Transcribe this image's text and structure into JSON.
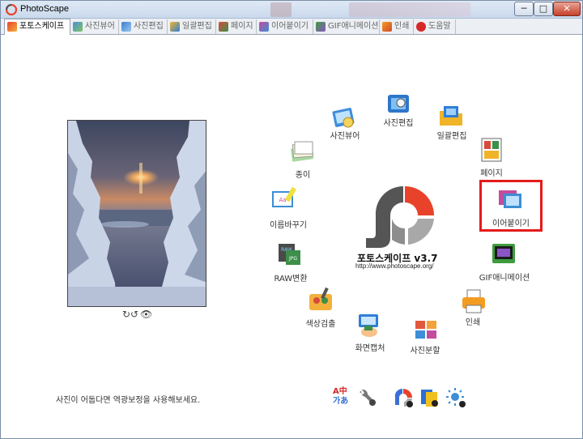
{
  "window": {
    "title": "PhotoScape",
    "min_label": "─",
    "max_label": "□",
    "close_label": "✕"
  },
  "tabs": [
    {
      "label": "포토스케이프",
      "icon": "photoscape-icon",
      "active": true
    },
    {
      "label": "사진뷰어",
      "icon": "viewer-icon"
    },
    {
      "label": "사진편집",
      "icon": "editor-icon"
    },
    {
      "label": "일괄편집",
      "icon": "batch-icon"
    },
    {
      "label": "페이지",
      "icon": "page-icon"
    },
    {
      "label": "이어붙이기",
      "icon": "combine-icon"
    },
    {
      "label": "GIF애니메이션",
      "icon": "gif-icon"
    },
    {
      "label": "인쇄",
      "icon": "print-icon"
    },
    {
      "label": "도움말",
      "icon": "help-icon"
    }
  ],
  "photo_controls": {
    "rotate": "↻↺",
    "view": "👁"
  },
  "menu": [
    {
      "label": "사진뷰어",
      "icon": "viewer-icon"
    },
    {
      "label": "사진편집",
      "icon": "editor-icon"
    },
    {
      "label": "일괄편집",
      "icon": "batch-icon"
    },
    {
      "label": "페이지",
      "icon": "page-icon"
    },
    {
      "label": "이어붙이기",
      "icon": "combine-icon"
    },
    {
      "label": "GIF애니메이션",
      "icon": "gif-icon"
    },
    {
      "label": "인쇄",
      "icon": "print-icon"
    },
    {
      "label": "사진분할",
      "icon": "splitter-icon"
    },
    {
      "label": "화면캡처",
      "icon": "screen-capture-icon"
    },
    {
      "label": "색상검출",
      "icon": "color-picker-icon"
    },
    {
      "label": "RAW변환",
      "icon": "raw-converter-icon"
    },
    {
      "label": "이름바꾸기",
      "icon": "rename-icon"
    },
    {
      "label": "종이",
      "icon": "paper-icon"
    }
  ],
  "logo": {
    "title": "포토스케이프 v3.7",
    "url": "http://www.photoscape.org/"
  },
  "status": {
    "tip": "사진이 어둡다면 역광보정을 사용해보세요."
  },
  "toolbar": {
    "lang_label_top": "A中",
    "lang_label_bottom": "가あ"
  },
  "colors": {
    "highlight": "#e51b1b",
    "logo_red": "#e8432a",
    "logo_dark": "#555555",
    "logo_gray": "#a8a8a8"
  }
}
